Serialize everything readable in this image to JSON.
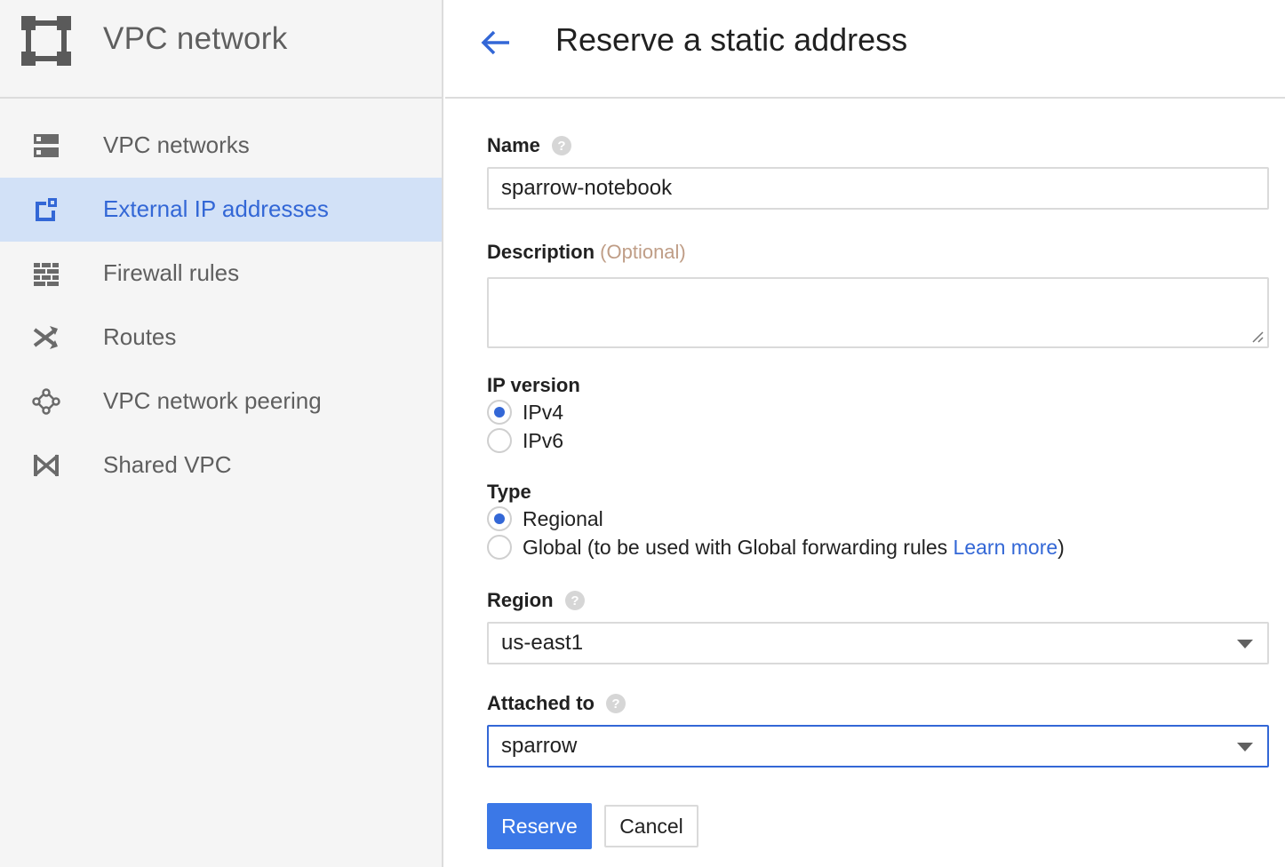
{
  "sidebar": {
    "product_title": "VPC network",
    "product_icon": "vpc-network-icon",
    "items": [
      {
        "label": "VPC networks",
        "icon": "vpc-networks-icon",
        "active": false
      },
      {
        "label": "External IP addresses",
        "icon": "external-ip-icon",
        "active": true
      },
      {
        "label": "Firewall rules",
        "icon": "firewall-icon",
        "active": false
      },
      {
        "label": "Routes",
        "icon": "routes-icon",
        "active": false
      },
      {
        "label": "VPC network peering",
        "icon": "peering-icon",
        "active": false
      },
      {
        "label": "Shared VPC",
        "icon": "shared-vpc-icon",
        "active": false
      }
    ]
  },
  "header": {
    "title": "Reserve a static address",
    "back_icon": "arrow-left-icon"
  },
  "form": {
    "name": {
      "label": "Name",
      "value": "sparrow-notebook"
    },
    "description": {
      "label": "Description",
      "optional": "(Optional)",
      "value": ""
    },
    "ip_version": {
      "label": "IP version",
      "options": [
        "IPv4",
        "IPv6"
      ],
      "selected": "IPv4"
    },
    "type": {
      "label": "Type",
      "options": [
        {
          "label": "Regional"
        },
        {
          "label": "Global (to be used with Global forwarding rules ",
          "link": "Learn more",
          "suffix": ")"
        }
      ],
      "selected": "Regional"
    },
    "region": {
      "label": "Region",
      "value": "us-east1"
    },
    "attached_to": {
      "label": "Attached to",
      "value": "sparrow"
    },
    "reserve_label": "Reserve",
    "cancel_label": "Cancel"
  },
  "colors": {
    "accent": "#3367d6",
    "primary_button": "#3b78e7",
    "active_nav_bg": "#d2e1f7",
    "optional_text": "#bf9d86"
  }
}
